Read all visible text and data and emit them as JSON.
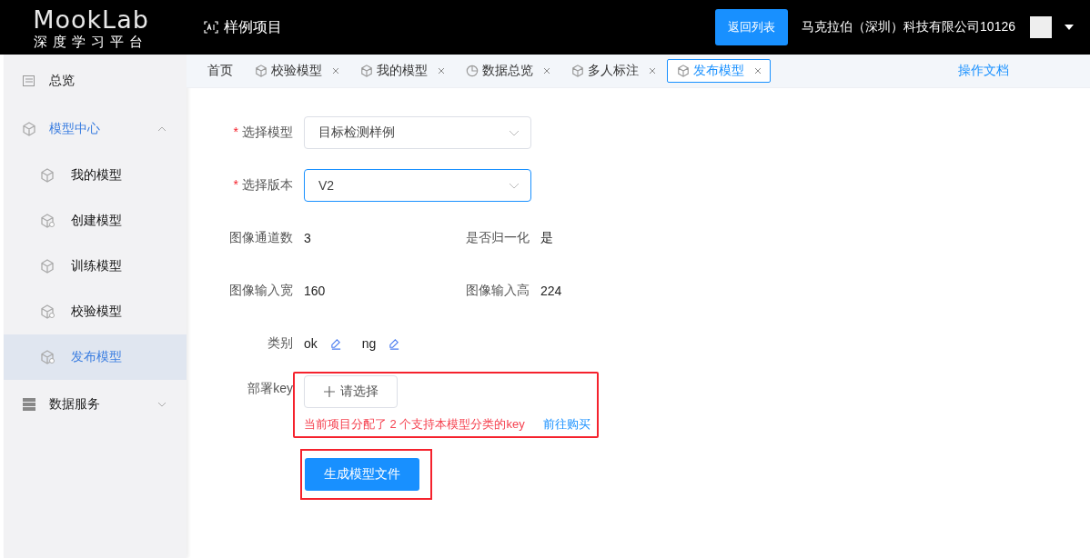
{
  "header": {
    "logo_title": "MookLab",
    "logo_subtitle": "深度学习平台",
    "project": "样例项目",
    "back_button": "返回列表",
    "company": "马克拉伯（深圳）科技有限公司10126"
  },
  "sidebar": {
    "items": [
      {
        "label": "总览",
        "selected": false
      },
      {
        "label": "模型中心",
        "selected": true,
        "expanded": true,
        "children": [
          {
            "label": "我的模型",
            "selected": false
          },
          {
            "label": "创建模型",
            "selected": false
          },
          {
            "label": "训练模型",
            "selected": false
          },
          {
            "label": "校验模型",
            "selected": false
          },
          {
            "label": "发布模型",
            "selected": true
          }
        ]
      },
      {
        "label": "数据服务",
        "selected": false,
        "expanded": false
      }
    ]
  },
  "tabs": [
    {
      "label": "首页",
      "closable": false,
      "selected": false
    },
    {
      "label": "校验模型",
      "closable": true,
      "selected": false
    },
    {
      "label": "我的模型",
      "closable": true,
      "selected": false
    },
    {
      "label": "数据总览",
      "closable": true,
      "selected": false
    },
    {
      "label": "多人标注",
      "closable": true,
      "selected": false
    },
    {
      "label": "发布模型",
      "closable": true,
      "selected": true
    }
  ],
  "docs_link": "操作文档",
  "form": {
    "selects": [
      {
        "label": "选择模型",
        "required_mark": "*",
        "value": "目标检测样例",
        "focused": false
      },
      {
        "label": "选择版本",
        "required_mark": "*",
        "value": "V2",
        "focused": true
      }
    ],
    "info_rows": [
      [
        {
          "label": "图像通道数",
          "value": "3"
        },
        {
          "label": "是否归一化",
          "value": "是"
        }
      ],
      [
        {
          "label": "图像输入宽",
          "value": "160"
        },
        {
          "label": "图像输入高",
          "value": "224"
        }
      ]
    ],
    "categories_label": "类别",
    "categories": [
      "ok",
      "ng"
    ],
    "key": {
      "label": "部署key",
      "button": "请选择",
      "hint": "当前项目分配了 2 个支持本模型分类的key",
      "link": "前往购买",
      "highlighted": true
    },
    "submit": {
      "label": "生成模型文件",
      "highlighted": true
    }
  }
}
